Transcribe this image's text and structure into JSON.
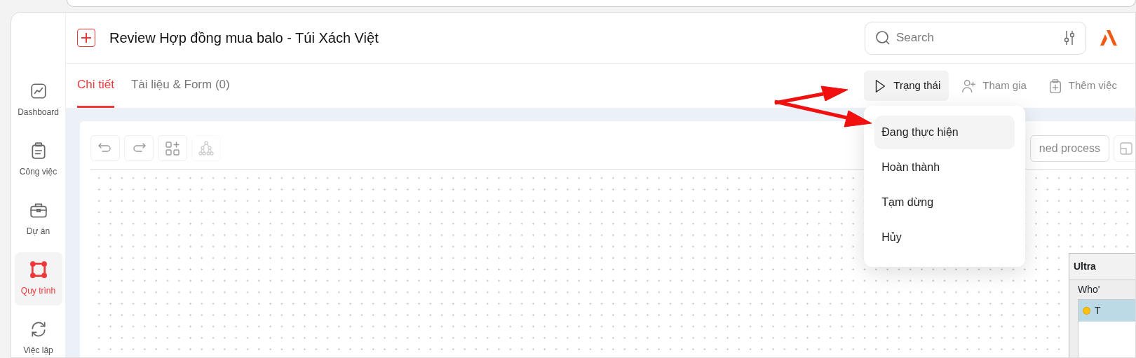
{
  "sidebar": {
    "items": [
      {
        "label": "Dashboard",
        "kind": "chart",
        "selected": false
      },
      {
        "label": "Công việc",
        "kind": "clipboard",
        "selected": false
      },
      {
        "label": "Dự án",
        "kind": "briefcase",
        "selected": false
      },
      {
        "label": "Quy trình",
        "kind": "process",
        "selected": true
      },
      {
        "label": "Việc lặp",
        "kind": "repeat",
        "selected": false
      }
    ]
  },
  "header": {
    "title": "Review Hợp đồng mua balo - Túi Xách Việt",
    "search": {
      "placeholder": "Search"
    }
  },
  "tabs": [
    {
      "label": "Chi tiết",
      "selected": true
    },
    {
      "label": "Tài liệu & Form (0)",
      "selected": false
    }
  ],
  "actions": [
    {
      "label": "Trạng thái",
      "kind": "play",
      "selected": true
    },
    {
      "label": "Tham gia",
      "kind": "user-plus",
      "selected": false
    },
    {
      "label": "Thêm việc",
      "kind": "clipboard-plus",
      "selected": false
    }
  ],
  "status_menu": {
    "items": [
      {
        "label": "Đang thực hiện",
        "selected": true
      },
      {
        "label": "Hoàn thành",
        "selected": false
      },
      {
        "label": "Tạm dừng",
        "selected": false
      },
      {
        "label": "Hủy",
        "selected": false
      }
    ]
  },
  "canvas_toolbar": {
    "tools": [
      {
        "kind": "undo",
        "disabled": false
      },
      {
        "kind": "redo",
        "disabled": false
      },
      {
        "kind": "add-block",
        "disabled": false
      },
      {
        "kind": "tree",
        "disabled": true
      }
    ],
    "process_button": "ned process"
  },
  "side_panel": {
    "title": "Ultra",
    "text": "Who'",
    "rows": [
      {
        "label": "T",
        "selected": true
      }
    ]
  }
}
